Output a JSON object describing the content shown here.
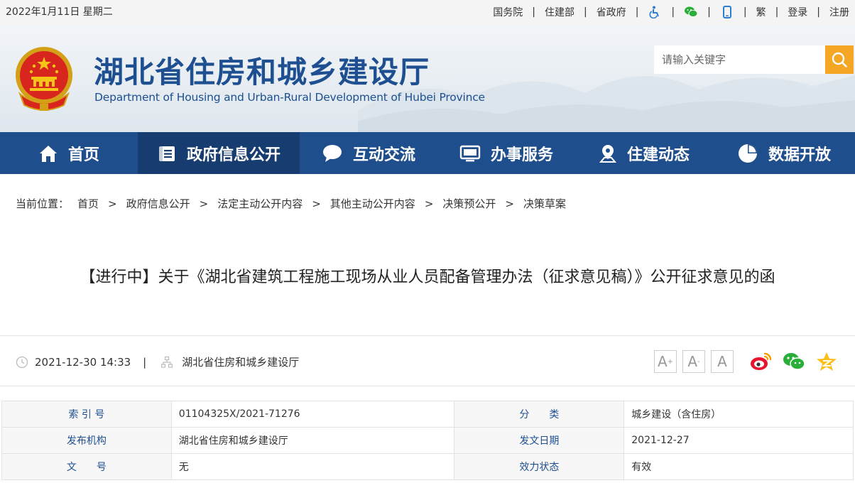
{
  "topbar": {
    "date": "2022年1月11日 星期二",
    "links": [
      "国务院",
      "住建部",
      "省政府"
    ],
    "icons": [
      "accessibility-icon",
      "wechat-icon",
      "mobile-icon"
    ],
    "trad": "繁",
    "login": "登录",
    "register": "注册"
  },
  "header": {
    "title": "湖北省住房和城乡建设厅",
    "subtitle": "Department of Housing and Urban-Rural Development of Hubei Province",
    "search_placeholder": "请输入关键字"
  },
  "nav": {
    "items": [
      {
        "label": "首页",
        "icon": "home-icon"
      },
      {
        "label": "政府信息公开",
        "icon": "document-list-icon",
        "active": true
      },
      {
        "label": "互动交流",
        "icon": "chat-bubble-icon"
      },
      {
        "label": "办事服务",
        "icon": "monitor-icon"
      },
      {
        "label": "住建动态",
        "icon": "location-pin-icon"
      },
      {
        "label": "数据开放",
        "icon": "pie-chart-icon"
      }
    ]
  },
  "breadcrumb": {
    "prefix": "当前位置：",
    "items": [
      "首页",
      "政府信息公开",
      "法定主动公开内容",
      "其他主动公开内容",
      "决策预公开",
      "决策草案"
    ]
  },
  "article": {
    "title": "【进行中】关于《湖北省建筑工程施工现场从业人员配备管理办法（征求意见稿）》公开征求意见的函",
    "datetime": "2021-12-30 14:33",
    "source": "湖北省住房和城乡建设厅",
    "font_buttons": [
      "A+",
      "A-",
      "A"
    ]
  },
  "info_table": {
    "rows": [
      {
        "k1": "索 引 号",
        "v1": "01104325X/2021-71276",
        "k2": "分　　类",
        "v2": "城乡建设（含住房）"
      },
      {
        "k1": "发布机构",
        "v1": "湖北省住房和城乡建设厅",
        "k2": "发文日期",
        "v2": "2021-12-27"
      },
      {
        "k1": "文　　号",
        "v1": "无",
        "k2": "效力状态",
        "v2": "有效"
      }
    ]
  },
  "colors": {
    "brand_blue": "#1f4e8c",
    "nav_active": "#163c70",
    "search_orange": "#f5a623",
    "title_blue": "#1d4f91"
  }
}
